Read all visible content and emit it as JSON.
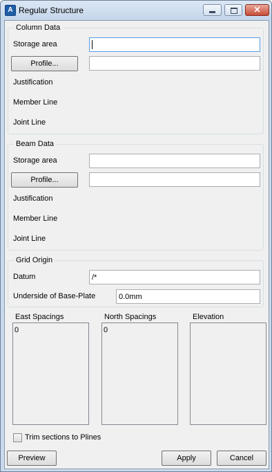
{
  "window": {
    "title": "Regular Structure"
  },
  "column_data": {
    "group_label": "Column Data",
    "storage_area_label": "Storage area",
    "storage_area_value": "",
    "profile_button": "Profile...",
    "profile_value": "",
    "justification_label": "Justification",
    "member_line_label": "Member Line",
    "joint_line_label": "Joint Line"
  },
  "beam_data": {
    "group_label": "Beam Data",
    "storage_area_label": "Storage area",
    "storage_area_value": "",
    "profile_button": "Profile...",
    "profile_value": "",
    "justification_label": "Justification",
    "member_line_label": "Member Line",
    "joint_line_label": "Joint Line"
  },
  "grid_origin": {
    "group_label": "Grid Origin",
    "datum_label": "Datum",
    "datum_value": "/*",
    "baseplate_label": "Underside of Base-Plate",
    "baseplate_value": "0.0mm"
  },
  "spacings": {
    "east": {
      "label": "East Spacings",
      "items": [
        "0"
      ]
    },
    "north": {
      "label": "North Spacings",
      "items": [
        "0"
      ]
    },
    "elevation": {
      "label": "Elevation",
      "items": []
    }
  },
  "trim_checkbox": {
    "label": "Trim sections to Plines",
    "checked": false
  },
  "buttons": {
    "preview": "Preview",
    "apply": "Apply",
    "cancel": "Cancel"
  }
}
